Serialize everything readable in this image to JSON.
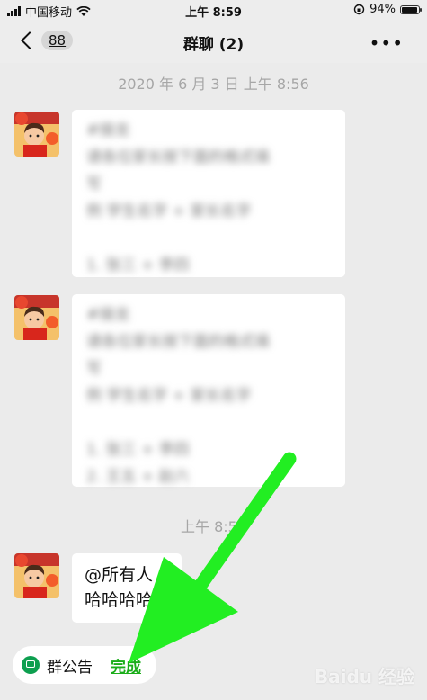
{
  "status_bar": {
    "carrier": "中国移动",
    "time": "上午 8:59",
    "battery": "94%"
  },
  "nav": {
    "back_count": "88",
    "title": "群聊 (2)",
    "more": "•••"
  },
  "chat": {
    "timestamp_1": "2020 年 6 月 3 日  上午 8:56",
    "timestamp_2": "上午 8:56",
    "messages": [
      {
        "text": "#接龙\n请各位家长按下面的格式填\n写\n例 学生名字 + 家长名字\n\n1. 张三 + 李四"
      },
      {
        "text": "#接龙\n请各位家长按下面的格式填\n写\n例 学生名字 + 家长名字\n\n1. 张三 + 李四\n2. 王五 + 赵六"
      },
      {
        "text": "@所有人\n哈哈哈哈"
      }
    ]
  },
  "bottom": {
    "notice_label": "群公告",
    "done_label": "完成"
  },
  "watermark": "Baidu 经验",
  "colors": {
    "background": "#ebebeb",
    "bar": "#ededed",
    "bubble": "#ffffff",
    "accent_green": "#1aad19",
    "annotation_arrow": "#22ee22"
  }
}
